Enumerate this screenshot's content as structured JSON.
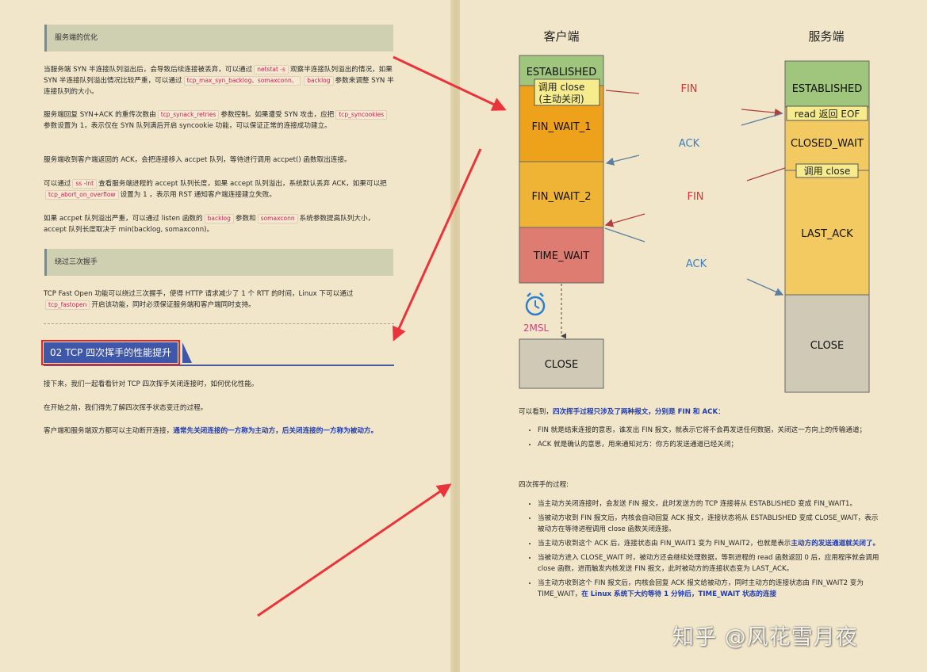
{
  "left": {
    "section1_title": "服务端的优化",
    "p1": {
      "a": "当服务端 SYN 半连接队列溢出后，会导致后续连接被丢弃，可以通过",
      "c1": "netstat -s",
      "b": "观察半连接队列溢出的情况，如果 SYN 半连接队列溢出情况比较严重，可以通过",
      "c2": "tcp_max_syn_backlog、somaxconn、",
      "c3": "backlog",
      "d": "参数来调整 SYN 半连接队列的大小。"
    },
    "p2": {
      "a": "服务端回复 SYN+ACK 的重传次数由",
      "c1": "tcp_synack_retries",
      "b": "参数控制。如果遭受 SYN 攻击，应把",
      "c2": "tcp_syncookies",
      "d": "参数设置为 1，表示仅在 SYN 队列满后开启 syncookie 功能，可以保证正常的连接成功建立。"
    },
    "p3": "服务端收到客户端返回的 ACK，会把连接移入 accpet 队列，等待进行调用 accpet() 函数取出连接。",
    "p4": {
      "a": "可以通过",
      "c1": "ss -lnt",
      "b": "查看服务端进程的 accept 队列长度，如果 accept 队列溢出，系统默认丢弃 ACK，如果可以把",
      "c2": "tcp_abort_on_overflow",
      "d": "设置为 1 ，表示用 RST 通知客户端连接建立失败。"
    },
    "p5": {
      "a": "如果 accpet 队列溢出严重，可以通过 listen 函数的",
      "c1": "backlog",
      "b": "参数和",
      "c2": "somaxconn",
      "d": "系统参数提高队列大小，accept 队列长度取决于 min(backlog, somaxconn)。"
    },
    "section2_title": "绕过三次握手",
    "p6": {
      "a": "TCP Fast Open 功能可以绕过三次握手，使得 HTTP 请求减少了 1 个 RTT 的时间，Linux 下可以通过",
      "c1": "tcp_fastopen",
      "b": "开启该功能，同时必须保证服务端和客户端同时支持。"
    },
    "heading": "02 TCP 四次挥手的性能提升",
    "p7": "接下来，我们一起看看针对 TCP 四次挥手关闭连接时，如何优化性能。",
    "p8": "在开始之前，我们得先了解四次挥手状态变迁的过程。",
    "p9": {
      "a": "客户端和服务端双方都可以主动断开连接，",
      "hl": "通常先关闭连接的一方称为主动方，后关闭连接的一方称为被动方。"
    }
  },
  "diagram": {
    "client_title": "客户端",
    "server_title": "服务端",
    "client_states": [
      "ESTABLISHED",
      "FIN_WAIT_1",
      "FIN_WAIT_2",
      "TIME_WAIT",
      "CLOSE"
    ],
    "client_call_line1": "调用 close",
    "client_call_line2": "(主动关闭)",
    "server_states": [
      "ESTABLISHED",
      "CLOSED_WAIT",
      "LAST_ACK",
      "CLOSE"
    ],
    "server_read_eof": "read 返回 EOF",
    "server_call": "调用 close",
    "messages": [
      "FIN",
      "ACK",
      "FIN",
      "ACK"
    ],
    "timer_label": "2MSL",
    "colors": {
      "established": "#9fc67c",
      "fin_wait": "#eea21c",
      "fin_wait_2": "#efb336",
      "time_wait": "#df7c71",
      "close": "#cfc9b6",
      "server_wait": "#f3ca62",
      "label_box": "#f6ec8e",
      "fin_text": "#e0303a",
      "ack_text": "#3a7fc2"
    }
  },
  "right": {
    "intro_a": "可以看到，",
    "intro_hl": "四次挥手过程只涉及了两种报文，分别是 FIN 和 ACK",
    "intro_b": "：",
    "bullets1": [
      "FIN 就是结束连接的意思，谁发出 FIN 报文，就表示它将不会再发送任何数据，关闭这一方向上的传输通道；",
      "ACK 就是确认的意思，用来通知对方：你方的发送通道已经关闭；"
    ],
    "process_title": "四次挥手的过程:",
    "b1": "当主动方关闭连接时，会发送 FIN 报文，此时发送方的 TCP 连接将从 ESTABLISHED 变成 FIN_WAIT1。",
    "b2": "当被动方收到 FIN 报文后，内核会自动回复 ACK 报文，连接状态将从 ESTABLISHED 变成 CLOSE_WAIT，表示被动方在等待进程调用 close 函数关闭连接。",
    "b3a": "当主动方收到这个 ACK 后，连接状态由 FIN_WAIT1 变为 FIN_WAIT2，也就是表示",
    "b3hl": "主动方的发送通道就关闭了。",
    "b4": "当被动方进入 CLOSE_WAIT 时，被动方还会继续处理数据，等到进程的 read 函数返回 0 后，应用程序就会调用 close 函数，进而触发内核发送 FIN 报文，此时被动方的连接状态变为 LAST_ACK。",
    "b5a": "当主动方收到这个 FIN 报文后，内核会回复 ACK 报文给被动方，同时主动方的连接状态由 FIN_WAIT2 变为 TIME_WAIT，",
    "b5hl": "在 Linux 系统下大约等待 1 分钟后，TIME_WAIT 状态的连接"
  },
  "watermark": "知乎 @风花雪月夜"
}
